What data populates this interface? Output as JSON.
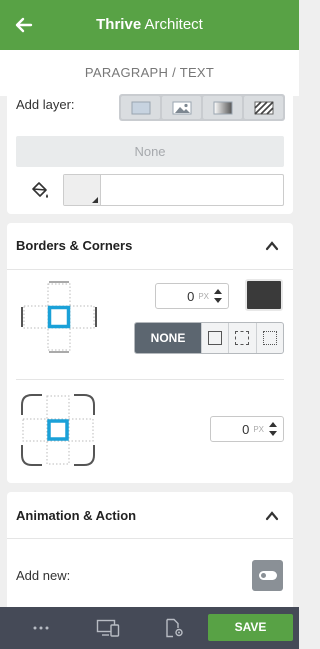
{
  "header": {
    "back_icon": "arrow-left-icon",
    "brand_bold": "Thrive",
    "brand_rest": " Architect",
    "color": "#58a245"
  },
  "subheader": {
    "title": "PARAGRAPH / TEXT"
  },
  "background_section": {
    "add_layer_label": "Add layer:",
    "layer_options": [
      {
        "icon": "solid-color-icon"
      },
      {
        "icon": "image-icon"
      },
      {
        "icon": "gradient-icon"
      },
      {
        "icon": "pattern-icon"
      }
    ],
    "none_label": "None",
    "color_picker_icon": "paint-bucket-icon"
  },
  "borders_section": {
    "title": "Borders & Corners",
    "border_width": {
      "value": "0",
      "unit": "PX"
    },
    "border_color": "#3a3a3a",
    "style_none_label": "NONE",
    "style_options": [
      {
        "icon": "solid-border-icon"
      },
      {
        "icon": "dashed-border-icon"
      },
      {
        "icon": "dotted-border-icon"
      }
    ],
    "corner_radius": {
      "value": "0",
      "unit": "PX"
    }
  },
  "animation_section": {
    "title": "Animation & Action",
    "add_new_label": "Add new:",
    "toggle_icon": "toggle-icon"
  },
  "bottom_bar": {
    "icons": [
      "more-dots-icon",
      "responsive-devices-icon",
      "page-settings-icon"
    ],
    "save_label": "SAVE",
    "bg_color": "#454a57"
  }
}
